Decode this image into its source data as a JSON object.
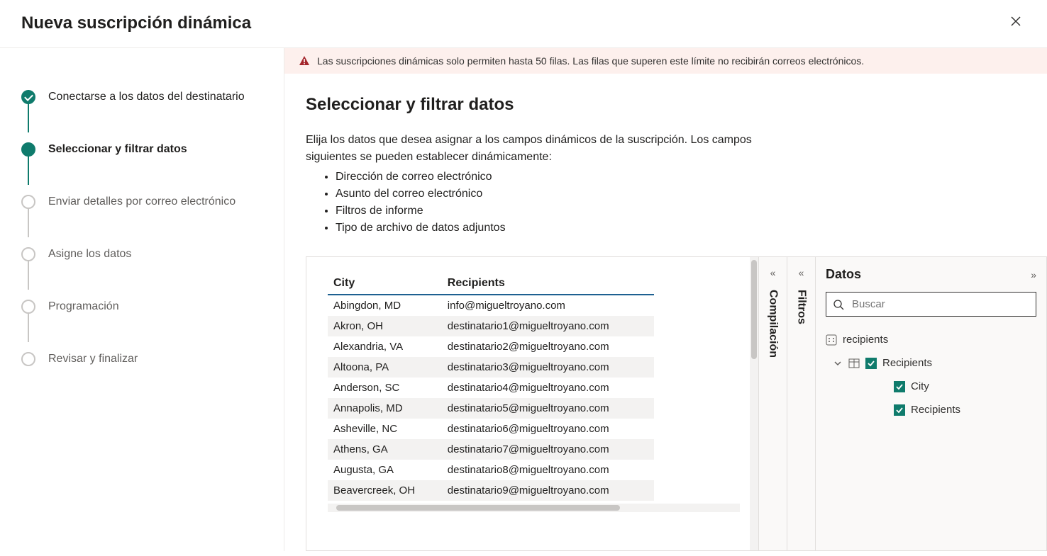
{
  "header": {
    "title": "Nueva suscripción dinámica"
  },
  "steps": [
    {
      "label": "Conectarse a los datos del destinatario",
      "state": "completed"
    },
    {
      "label": "Seleccionar y filtrar datos",
      "state": "active"
    },
    {
      "label": "Enviar detalles por correo electrónico",
      "state": "pending"
    },
    {
      "label": "Asigne los datos",
      "state": "pending"
    },
    {
      "label": "Programación",
      "state": "pending"
    },
    {
      "label": "Revisar y finalizar",
      "state": "pending"
    }
  ],
  "warning": "Las suscripciones dinámicas solo permiten hasta 50 filas. Las filas que superen este límite no recibirán correos electrónicos.",
  "content": {
    "heading": "Seleccionar y filtrar datos",
    "intro": "Elija los datos que desea asignar a los campos dinámicos de la suscripción. Los campos siguientes se pueden establecer dinámicamente:",
    "bullets": [
      "Dirección de correo electrónico",
      "Asunto del correo electrónico",
      "Filtros de informe",
      "Tipo de archivo de datos adjuntos"
    ]
  },
  "table": {
    "headers": [
      "City",
      "Recipients"
    ],
    "rows": [
      [
        "Abingdon, MD",
        "info@migueltroyano.com"
      ],
      [
        "Akron, OH",
        "destinatario1@migueltroyano.com"
      ],
      [
        "Alexandria, VA",
        "destinatario2@migueltroyano.com"
      ],
      [
        "Altoona, PA",
        "destinatario3@migueltroyano.com"
      ],
      [
        "Anderson, SC",
        "destinatario4@migueltroyano.com"
      ],
      [
        "Annapolis, MD",
        "destinatario5@migueltroyano.com"
      ],
      [
        "Asheville, NC",
        "destinatario6@migueltroyano.com"
      ],
      [
        "Athens, GA",
        "destinatario7@migueltroyano.com"
      ],
      [
        "Augusta, GA",
        "destinatario8@migueltroyano.com"
      ],
      [
        "Beavercreek, OH",
        "destinatario9@migueltroyano.com"
      ]
    ]
  },
  "panels": {
    "compilation_label": "Compilación",
    "filters_label": "Filtros",
    "data_title": "Datos",
    "search_placeholder": "Buscar"
  },
  "tree": {
    "root": "recipients",
    "table_node": "Recipients",
    "fields": [
      "City",
      "Recipients"
    ]
  }
}
